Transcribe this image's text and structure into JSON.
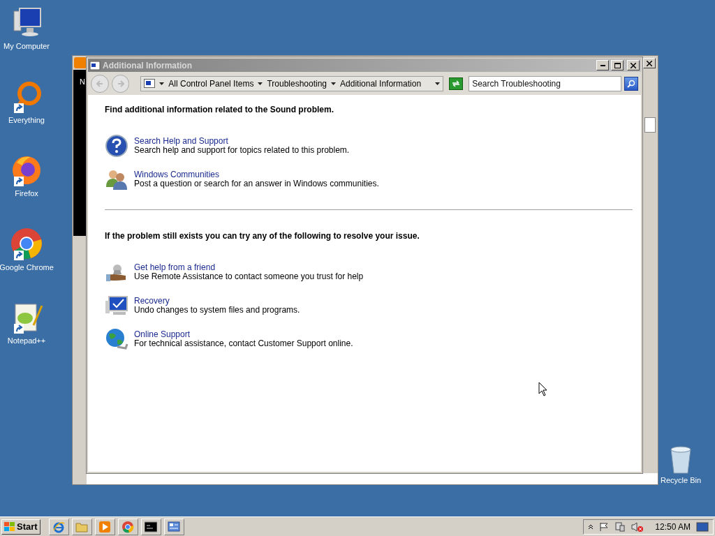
{
  "desktop_icons": [
    {
      "kind": "computer",
      "label": "My Computer",
      "shortcut": false
    },
    {
      "kind": "everything",
      "label": "Everything",
      "shortcut": true
    },
    {
      "kind": "firefox",
      "label": "Firefox",
      "shortcut": true
    },
    {
      "kind": "chrome",
      "label": "Google Chrome",
      "shortcut": true
    },
    {
      "kind": "notepad",
      "label": "Notepad++",
      "shortcut": true
    }
  ],
  "recycle_bin": {
    "label": "Recycle Bin"
  },
  "back_window": {
    "text": "N"
  },
  "window": {
    "title": "Additional Information",
    "breadcrumb": [
      "All Control Panel Items",
      "Troubleshooting",
      "Additional Information"
    ],
    "search": {
      "placeholder": "Search Troubleshooting"
    }
  },
  "sections": [
    {
      "heading": "Find additional information related to the Sound problem.",
      "items": [
        {
          "kind": "help",
          "title": "Search Help and Support",
          "description": "Search help and support for topics related to this problem."
        },
        {
          "kind": "people",
          "title": "Windows Communities",
          "description": "Post a question or search for an answer in Windows communities."
        }
      ]
    },
    {
      "heading": "If the problem still exists you can try any of the following to resolve your issue.",
      "items": [
        {
          "kind": "friend",
          "title": "Get help from a friend",
          "description": "Use Remote Assistance to contact someone you trust for help"
        },
        {
          "kind": "recovery",
          "title": "Recovery",
          "description": "Undo changes to system files and programs."
        },
        {
          "kind": "globe",
          "title": "Online Support",
          "description": "For technical assistance, contact Customer Support online."
        }
      ]
    }
  ],
  "taskbar": {
    "start": "Start",
    "apps": [
      {
        "kind": "ie"
      },
      {
        "kind": "folder"
      },
      {
        "kind": "media"
      },
      {
        "kind": "chrome"
      },
      {
        "kind": "cmd"
      },
      {
        "kind": "control"
      }
    ],
    "clock": "12:50 AM"
  }
}
